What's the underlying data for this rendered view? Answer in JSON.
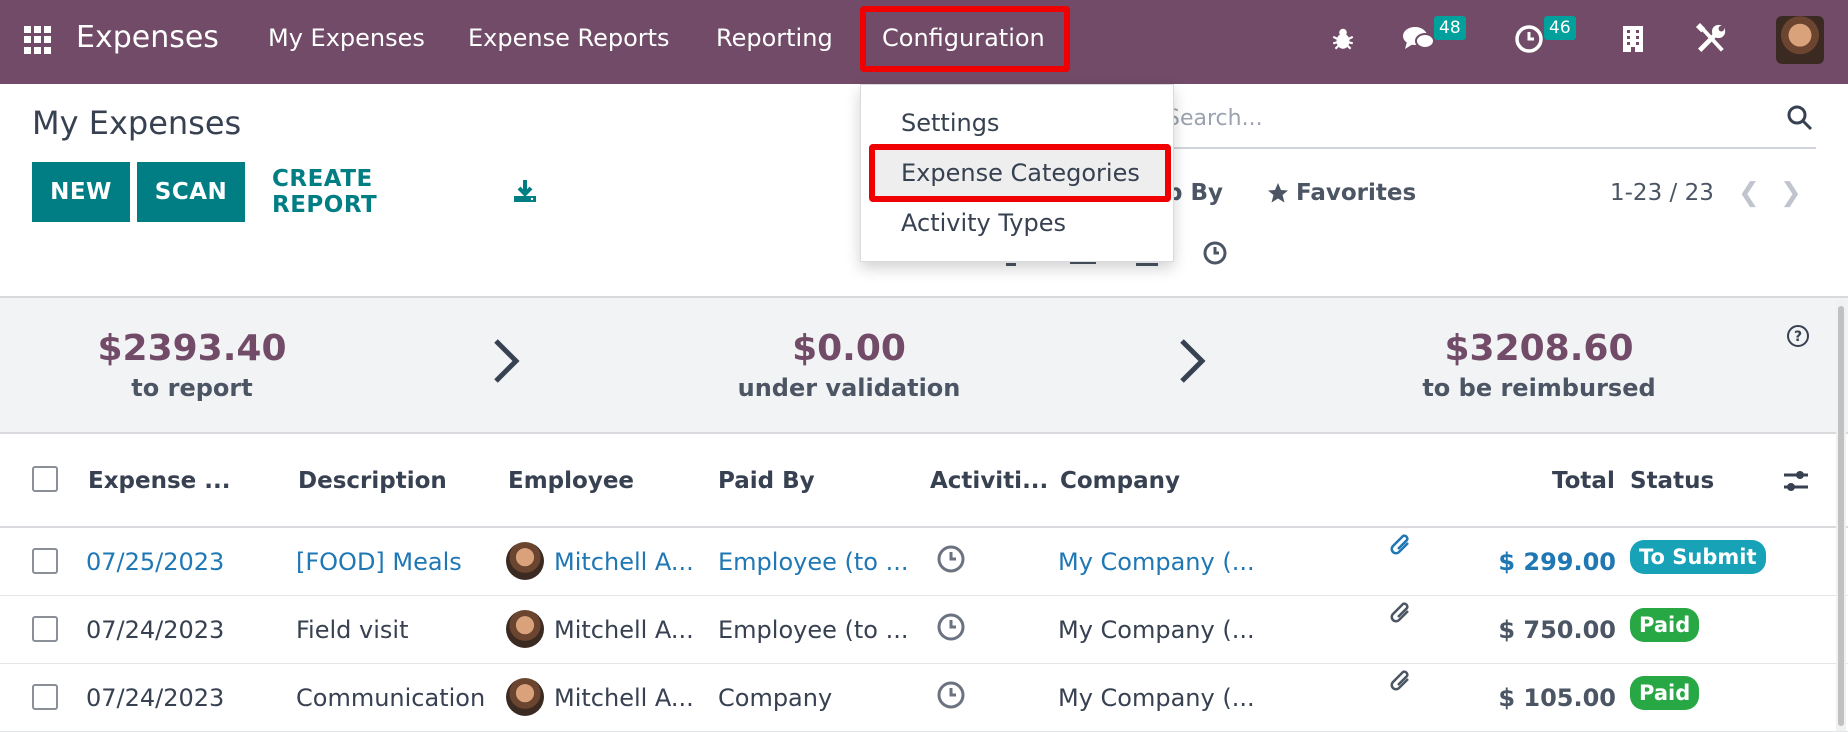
{
  "navbar": {
    "app_name": "Expenses",
    "menu": [
      "My Expenses",
      "Expense Reports",
      "Reporting",
      "Configuration"
    ],
    "active_menu": "Configuration",
    "messages_count": "48",
    "activities_count": "46",
    "icons": [
      "apps-grid-icon",
      "bug-icon",
      "chat-icon",
      "clock-icon",
      "building-icon",
      "tools-icon",
      "user-avatar"
    ]
  },
  "dropdown": {
    "items": [
      "Settings",
      "Expense Categories",
      "Activity Types"
    ],
    "highlighted": "Expense Categories"
  },
  "control_panel": {
    "title": "My Expenses",
    "new_label": "NEW",
    "scan_label": "SCAN",
    "create_report_label": "CREATE REPORT",
    "search_placeholder": "Search...",
    "group_by_label": "p By",
    "favorites_label": "Favorites",
    "pager": "1-23 / 23"
  },
  "summary": {
    "to_report_amount": "$2393.40",
    "to_report_label": "to report",
    "validation_amount": "$0.00",
    "validation_label": "under validation",
    "reimbursed_amount": "$3208.60",
    "reimbursed_label": "to be reimbursed"
  },
  "table": {
    "headers": [
      "Expense ...",
      "Description",
      "Employee",
      "Paid By",
      "Activiti...",
      "Company",
      "Total",
      "Status"
    ],
    "rows": [
      {
        "date": "07/25/2023",
        "description": "[FOOD] Meals",
        "employee": "Mitchell A...",
        "paid_by": "Employee (to ...",
        "company": "My Company (...",
        "total": "$ 299.00",
        "status": "To Submit"
      },
      {
        "date": "07/24/2023",
        "description": "Field visit",
        "employee": "Mitchell A...",
        "paid_by": "Employee (to ...",
        "company": "My Company (...",
        "total": "$ 750.00",
        "status": "Paid"
      },
      {
        "date": "07/24/2023",
        "description": "Communication",
        "employee": "Mitchell A...",
        "paid_by": "Company",
        "company": "My Company (...",
        "total": "$ 105.00",
        "status": "Paid"
      }
    ]
  },
  "colors": {
    "navbar": "#714b67",
    "primary": "#017e84",
    "highlight": "#f00000",
    "status_to_submit": "#17a2b8",
    "status_paid": "#28a745"
  }
}
